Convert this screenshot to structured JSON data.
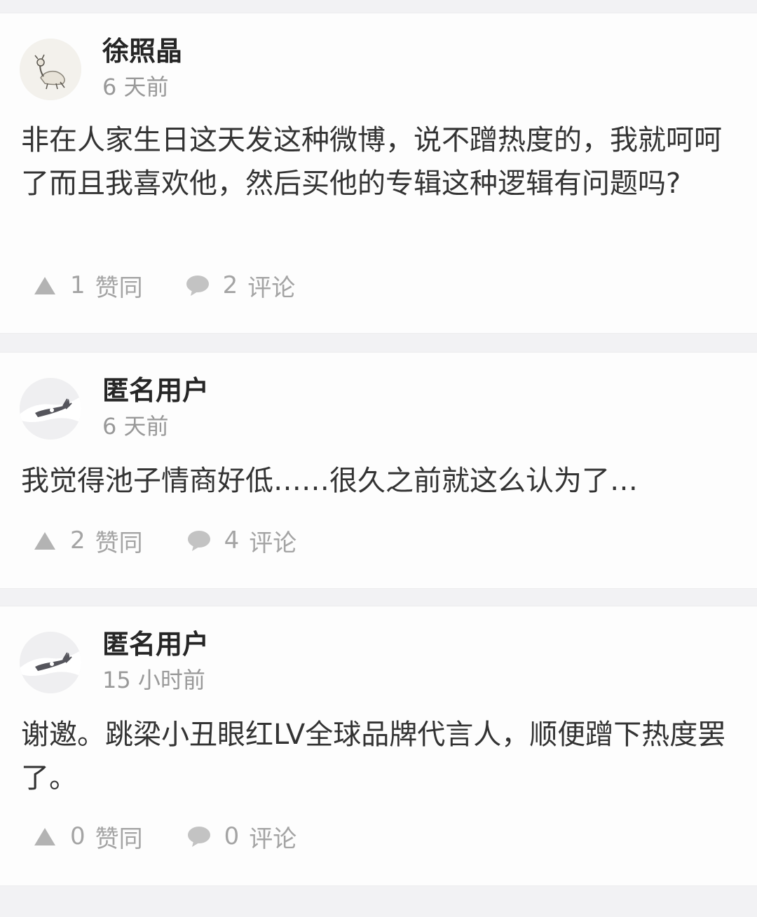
{
  "posts": [
    {
      "author": "徐照晶",
      "time": "6 天前",
      "text": "非在人家生日这天发这种微博，说不蹭热度的，我就呵呵了而且我喜欢他，然后买他的专辑这种逻辑有问题吗?",
      "likes": "1",
      "like_label": "赞同",
      "comments": "2",
      "comment_label": "评论"
    },
    {
      "author": "匿名用户",
      "time": "6 天前",
      "text": "我觉得池子情商好低……很久之前就这么认为了…",
      "likes": "2",
      "like_label": "赞同",
      "comments": "4",
      "comment_label": "评论"
    },
    {
      "author": "匿名用户",
      "time": "15 小时前",
      "text": "谢邀。跳梁小丑眼红LV全球品牌代言人，顺便蹭下热度罢了。",
      "likes": "0",
      "like_label": "赞同",
      "comments": "0",
      "comment_label": "评论"
    }
  ],
  "icons": {
    "like": "upvote-triangle-icon",
    "comment": "speech-bubble-icon",
    "avatar_1": "goat-drawing-avatar",
    "avatar_anon": "anonymous-mask-avatar"
  },
  "colors": {
    "background": "#f2f2f4",
    "card": "#fdfdfd",
    "username": "#262626",
    "meta": "#999999",
    "action": "#a4a4a4"
  }
}
